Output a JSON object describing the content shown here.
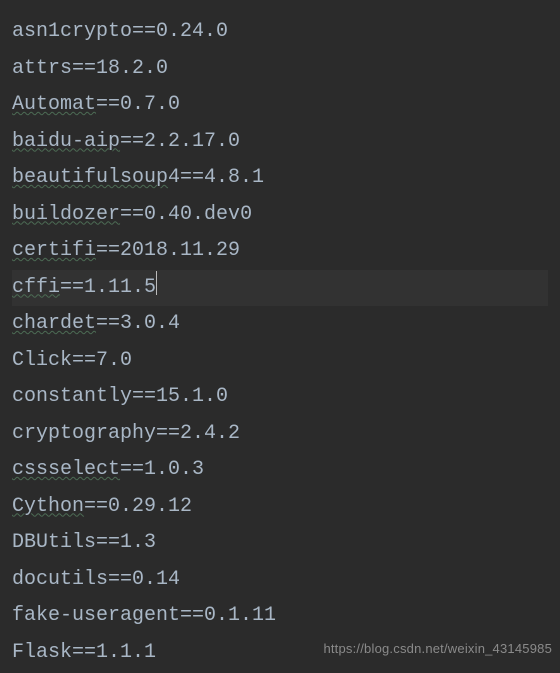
{
  "lines": [
    {
      "name": "asn1crypto",
      "sep": "==",
      "ver": "0.24.0",
      "squiggle": false
    },
    {
      "name": "attrs",
      "sep": "==",
      "ver": "18.2.0",
      "squiggle": false
    },
    {
      "name": "Automat",
      "sep": "==",
      "ver": "0.7.0",
      "squiggle": true
    },
    {
      "name": "baidu-aip",
      "sep": "==",
      "ver": "2.2.17.0",
      "squiggle": true
    },
    {
      "name": "beautifulsoup",
      "sep": "4==",
      "ver": "4.8.1",
      "squiggle": true
    },
    {
      "name": "buildozer",
      "sep": "==",
      "ver": "0.40.dev0",
      "squiggle": true
    },
    {
      "name": "certifi",
      "sep": "==",
      "ver": "2018.11.29",
      "squiggle": true
    },
    {
      "name": "cffi",
      "sep": "==",
      "ver": "1.11.5",
      "squiggle": true,
      "current": true,
      "caret": true
    },
    {
      "name": "chardet",
      "sep": "==",
      "ver": "3.0.4",
      "squiggle": true
    },
    {
      "name": "Click",
      "sep": "==",
      "ver": "7.0",
      "squiggle": false
    },
    {
      "name": "constantly",
      "sep": "==",
      "ver": "15.1.0",
      "squiggle": false
    },
    {
      "name": "cryptography",
      "sep": "==",
      "ver": "2.4.2",
      "squiggle": false
    },
    {
      "name": "cssselect",
      "sep": "==",
      "ver": "1.0.3",
      "squiggle": true
    },
    {
      "name": "Cython",
      "sep": "==",
      "ver": "0.29.12",
      "squiggle": true
    },
    {
      "name": "DBUtils",
      "sep": "==",
      "ver": "1.3",
      "squiggle": false
    },
    {
      "name": "docutils",
      "sep": "==",
      "ver": "0.14",
      "squiggle": false
    },
    {
      "name": "fake-useragent",
      "sep": "==",
      "ver": "0.1.11",
      "squiggle": false
    },
    {
      "name": "Flask",
      "sep": "==",
      "ver": "1.1.1",
      "squiggle": false
    }
  ],
  "watermark": "https://blog.csdn.net/weixin_43145985"
}
